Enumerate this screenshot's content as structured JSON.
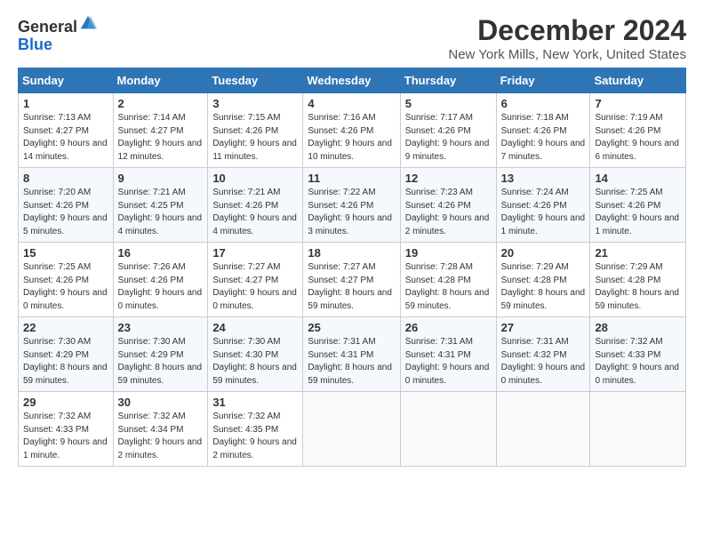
{
  "header": {
    "logo_general": "General",
    "logo_blue": "Blue",
    "title": "December 2024",
    "location": "New York Mills, New York, United States"
  },
  "weekdays": [
    "Sunday",
    "Monday",
    "Tuesday",
    "Wednesday",
    "Thursday",
    "Friday",
    "Saturday"
  ],
  "weeks": [
    [
      {
        "day": "1",
        "sunrise": "7:13 AM",
        "sunset": "4:27 PM",
        "daylight": "9 hours and 14 minutes."
      },
      {
        "day": "2",
        "sunrise": "7:14 AM",
        "sunset": "4:27 PM",
        "daylight": "9 hours and 12 minutes."
      },
      {
        "day": "3",
        "sunrise": "7:15 AM",
        "sunset": "4:26 PM",
        "daylight": "9 hours and 11 minutes."
      },
      {
        "day": "4",
        "sunrise": "7:16 AM",
        "sunset": "4:26 PM",
        "daylight": "9 hours and 10 minutes."
      },
      {
        "day": "5",
        "sunrise": "7:17 AM",
        "sunset": "4:26 PM",
        "daylight": "9 hours and 9 minutes."
      },
      {
        "day": "6",
        "sunrise": "7:18 AM",
        "sunset": "4:26 PM",
        "daylight": "9 hours and 7 minutes."
      },
      {
        "day": "7",
        "sunrise": "7:19 AM",
        "sunset": "4:26 PM",
        "daylight": "9 hours and 6 minutes."
      }
    ],
    [
      {
        "day": "8",
        "sunrise": "7:20 AM",
        "sunset": "4:26 PM",
        "daylight": "9 hours and 5 minutes."
      },
      {
        "day": "9",
        "sunrise": "7:21 AM",
        "sunset": "4:25 PM",
        "daylight": "9 hours and 4 minutes."
      },
      {
        "day": "10",
        "sunrise": "7:21 AM",
        "sunset": "4:26 PM",
        "daylight": "9 hours and 4 minutes."
      },
      {
        "day": "11",
        "sunrise": "7:22 AM",
        "sunset": "4:26 PM",
        "daylight": "9 hours and 3 minutes."
      },
      {
        "day": "12",
        "sunrise": "7:23 AM",
        "sunset": "4:26 PM",
        "daylight": "9 hours and 2 minutes."
      },
      {
        "day": "13",
        "sunrise": "7:24 AM",
        "sunset": "4:26 PM",
        "daylight": "9 hours and 1 minute."
      },
      {
        "day": "14",
        "sunrise": "7:25 AM",
        "sunset": "4:26 PM",
        "daylight": "9 hours and 1 minute."
      }
    ],
    [
      {
        "day": "15",
        "sunrise": "7:25 AM",
        "sunset": "4:26 PM",
        "daylight": "9 hours and 0 minutes."
      },
      {
        "day": "16",
        "sunrise": "7:26 AM",
        "sunset": "4:26 PM",
        "daylight": "9 hours and 0 minutes."
      },
      {
        "day": "17",
        "sunrise": "7:27 AM",
        "sunset": "4:27 PM",
        "daylight": "9 hours and 0 minutes."
      },
      {
        "day": "18",
        "sunrise": "7:27 AM",
        "sunset": "4:27 PM",
        "daylight": "8 hours and 59 minutes."
      },
      {
        "day": "19",
        "sunrise": "7:28 AM",
        "sunset": "4:28 PM",
        "daylight": "8 hours and 59 minutes."
      },
      {
        "day": "20",
        "sunrise": "7:29 AM",
        "sunset": "4:28 PM",
        "daylight": "8 hours and 59 minutes."
      },
      {
        "day": "21",
        "sunrise": "7:29 AM",
        "sunset": "4:28 PM",
        "daylight": "8 hours and 59 minutes."
      }
    ],
    [
      {
        "day": "22",
        "sunrise": "7:30 AM",
        "sunset": "4:29 PM",
        "daylight": "8 hours and 59 minutes."
      },
      {
        "day": "23",
        "sunrise": "7:30 AM",
        "sunset": "4:29 PM",
        "daylight": "8 hours and 59 minutes."
      },
      {
        "day": "24",
        "sunrise": "7:30 AM",
        "sunset": "4:30 PM",
        "daylight": "8 hours and 59 minutes."
      },
      {
        "day": "25",
        "sunrise": "7:31 AM",
        "sunset": "4:31 PM",
        "daylight": "8 hours and 59 minutes."
      },
      {
        "day": "26",
        "sunrise": "7:31 AM",
        "sunset": "4:31 PM",
        "daylight": "9 hours and 0 minutes."
      },
      {
        "day": "27",
        "sunrise": "7:31 AM",
        "sunset": "4:32 PM",
        "daylight": "9 hours and 0 minutes."
      },
      {
        "day": "28",
        "sunrise": "7:32 AM",
        "sunset": "4:33 PM",
        "daylight": "9 hours and 0 minutes."
      }
    ],
    [
      {
        "day": "29",
        "sunrise": "7:32 AM",
        "sunset": "4:33 PM",
        "daylight": "9 hours and 1 minute."
      },
      {
        "day": "30",
        "sunrise": "7:32 AM",
        "sunset": "4:34 PM",
        "daylight": "9 hours and 2 minutes."
      },
      {
        "day": "31",
        "sunrise": "7:32 AM",
        "sunset": "4:35 PM",
        "daylight": "9 hours and 2 minutes."
      },
      null,
      null,
      null,
      null
    ]
  ]
}
